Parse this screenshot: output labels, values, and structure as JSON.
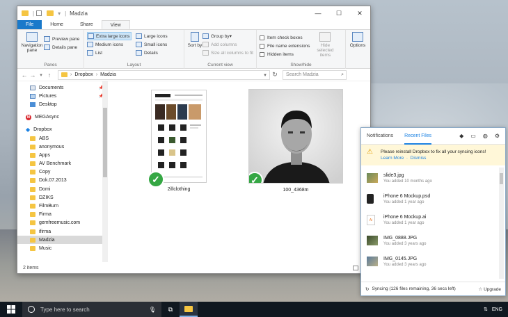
{
  "explorer": {
    "title": "Madzia",
    "tabs": [
      "File",
      "Home",
      "Share",
      "View"
    ],
    "active_tab": "View",
    "ribbon": {
      "panes": {
        "navigation_pane": "Navigation pane",
        "preview_pane": "Preview pane",
        "details_pane": "Details pane",
        "label": "Panes"
      },
      "layout": {
        "items": [
          "Extra large icons",
          "Large icons",
          "Medium icons",
          "Small icons",
          "List",
          "Details"
        ],
        "selected": "Extra large icons",
        "label": "Layout"
      },
      "current_view": {
        "sort_by": "Sort by",
        "group_by": "Group by",
        "add_columns": "Add columns",
        "size_columns": "Size all columns to fit",
        "label": "Current view"
      },
      "show_hide": {
        "item_check_boxes": "Item check boxes",
        "file_name_extensions": "File name extensions",
        "hidden_items": "Hidden items",
        "hide_selected": "Hide selected items",
        "label": "Show/hide"
      },
      "options": "Options"
    },
    "address": {
      "crumbs": [
        "Dropbox",
        "Madzia"
      ]
    },
    "search_placeholder": "Search Madzia",
    "nav": {
      "quick": [
        {
          "label": "Documents",
          "icon": "document-folder-icon",
          "pinned": true
        },
        {
          "label": "Pictures",
          "icon": "pictures-folder-icon",
          "pinned": true
        },
        {
          "label": "Desktop",
          "icon": "desktop-folder-icon",
          "pinned": false
        }
      ],
      "mega": "MEGAsync",
      "dropbox": "Dropbox",
      "folders": [
        "ABS",
        "anonymous",
        "Apps",
        "AV Benchmark",
        "Copy",
        "Dok.07.2013",
        "Domi",
        "DZIKS",
        "FilmBurn",
        "Firma",
        "gemfreemusic.com",
        "ifirma",
        "Madzia",
        "Music"
      ],
      "selected_folder": "Madzia"
    },
    "files": [
      {
        "name": "2illclothing",
        "status": "synced"
      },
      {
        "name": "100_4368m",
        "status": "synced"
      }
    ],
    "status": "2 items"
  },
  "dropbox": {
    "tabs": [
      "Notifications",
      "Recent Files"
    ],
    "active_tab": "Recent Files",
    "warning": {
      "text": "Please reinstall Dropbox to fix all your syncing icons!",
      "learn_more": "Learn More",
      "dismiss": "Dismiss"
    },
    "recent": [
      {
        "name": "slide3.jpg",
        "meta": "You added 10 months ago"
      },
      {
        "name": "iPhone 6 Mockup.psd",
        "meta": "You added 1 year ago"
      },
      {
        "name": "iPhone 6 Mockup.ai",
        "meta": "You added 1 year ago"
      },
      {
        "name": "IMG_0888.JPG",
        "meta": "You added 3 years ago"
      },
      {
        "name": "IMG_0145.JPG",
        "meta": "You added 3 years ago"
      }
    ],
    "sync_status": "Syncing (126 files remaining, 36 secs left)",
    "upgrade": "Upgrade"
  },
  "taskbar": {
    "search_placeholder": "Type here to search",
    "language": "ENG"
  }
}
